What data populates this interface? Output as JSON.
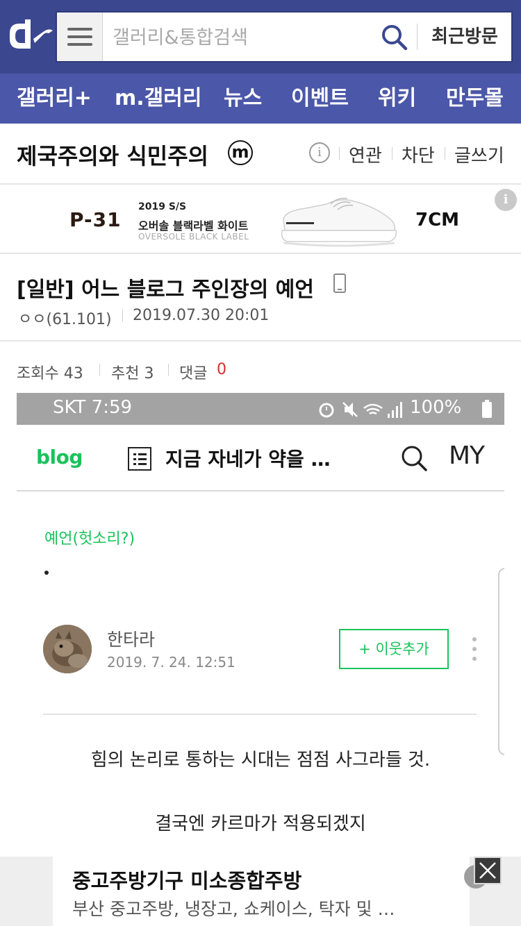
{
  "header": {
    "search_placeholder": "갤러리&통합검색",
    "recent_label": "최근방문",
    "nav": [
      "갤러리+",
      "m.갤러리",
      "뉴스",
      "이벤트",
      "위키",
      "만두몰"
    ]
  },
  "gallery": {
    "title": "제국주의와 식민주의",
    "badge": "m",
    "info_glyph": "i",
    "links": [
      "연관",
      "차단",
      "글쓰기"
    ]
  },
  "ad_banner": {
    "brand": "P-31",
    "season": "2019 S/S",
    "product": "오버솔 블랙라벨 화이트",
    "subtitle": "OVERSOLE BLACK LABEL",
    "height": "7CM",
    "info_glyph": "i"
  },
  "post": {
    "title": "[일반] 어느 블로그 주인장의 예언",
    "author": "ㅇㅇ(61.101)",
    "date": "2019.07.30 20:01",
    "stats": {
      "views_label": "조회수 43",
      "recommend_label": "추천 3",
      "comments_label": "댓글",
      "comments_count": "0"
    }
  },
  "embedded": {
    "status_left": "SKT 7:59",
    "status_right": "100%",
    "blog_logo": "blog",
    "blog_title": "지금 자네가 약을 …",
    "my_label": "MY",
    "category": "예언(헛소리?)",
    "author": "한타라",
    "date": "2019. 7. 24. 12:51",
    "neighbor_button": "+ 이웃추가",
    "body_lines": [
      "힘의 논리로 통하는 시대는 점점 사그라들 것.",
      "결국엔 카르마가 적용되겠지"
    ]
  },
  "bottom_ad": {
    "title": "중고주방기구 미소종합주방",
    "description": "부산 중고주방, 냉장고, 쇼케이스, 탁자 및 …"
  },
  "colors": {
    "header_bg": "#3b4890",
    "nav_bg": "#4b57a8",
    "blog_green": "#19c25a",
    "comment_red": "#d32f2f"
  }
}
